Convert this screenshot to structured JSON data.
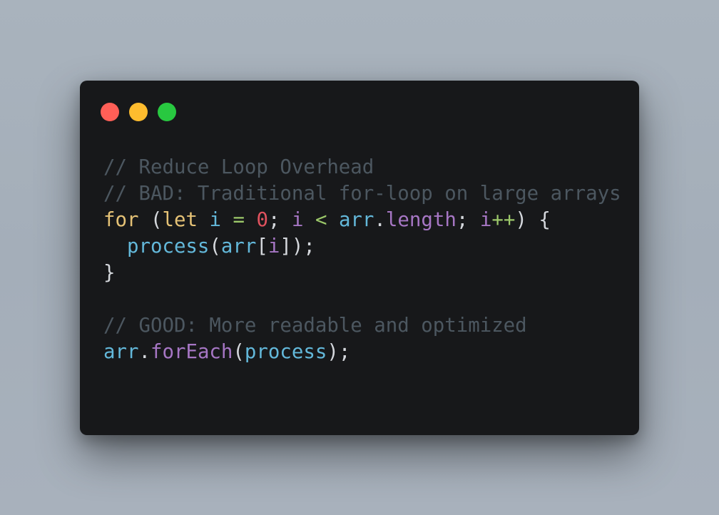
{
  "window": {
    "controls": [
      {
        "name": "close",
        "color": "#ff5f57"
      },
      {
        "name": "minimize",
        "color": "#febc2e"
      },
      {
        "name": "maximize",
        "color": "#28c840"
      }
    ]
  },
  "colors": {
    "background": "#a6b0bb",
    "editor": "#17181a",
    "comment": "#4c5760",
    "keyword": "#e5c276",
    "number": "#e0525e",
    "identifier": "#63b8da",
    "variable": "#a676c4",
    "operator": "#9cc86a",
    "punctuation": "#d4d7dc"
  },
  "code": {
    "lines": [
      [
        {
          "t": "// Reduce Loop Overhead",
          "k": "comment"
        }
      ],
      [
        {
          "t": "// BAD: Traditional for-loop on large arrays",
          "k": "comment"
        }
      ],
      [
        {
          "t": "for",
          "k": "keyword"
        },
        {
          "t": " (",
          "k": "punct"
        },
        {
          "t": "let",
          "k": "keyword"
        },
        {
          "t": " ",
          "k": "punct"
        },
        {
          "t": "i",
          "k": "ident"
        },
        {
          "t": " ",
          "k": "punct"
        },
        {
          "t": "=",
          "k": "op"
        },
        {
          "t": " ",
          "k": "punct"
        },
        {
          "t": "0",
          "k": "number"
        },
        {
          "t": "; ",
          "k": "punct"
        },
        {
          "t": "i",
          "k": "var"
        },
        {
          "t": " ",
          "k": "punct"
        },
        {
          "t": "<",
          "k": "op"
        },
        {
          "t": " ",
          "k": "punct"
        },
        {
          "t": "arr",
          "k": "ident"
        },
        {
          "t": ".",
          "k": "punct"
        },
        {
          "t": "length",
          "k": "var"
        },
        {
          "t": "; ",
          "k": "punct"
        },
        {
          "t": "i",
          "k": "var"
        },
        {
          "t": "++",
          "k": "op"
        },
        {
          "t": ") {",
          "k": "punct"
        }
      ],
      [
        {
          "t": "  ",
          "k": "punct"
        },
        {
          "t": "process",
          "k": "ident"
        },
        {
          "t": "(",
          "k": "punct"
        },
        {
          "t": "arr",
          "k": "ident"
        },
        {
          "t": "[",
          "k": "punct"
        },
        {
          "t": "i",
          "k": "var"
        },
        {
          "t": "]);",
          "k": "punct"
        }
      ],
      [
        {
          "t": "}",
          "k": "punct"
        }
      ],
      [],
      [
        {
          "t": "// GOOD: More readable and optimized",
          "k": "comment"
        }
      ],
      [
        {
          "t": "arr",
          "k": "ident"
        },
        {
          "t": ".",
          "k": "punct"
        },
        {
          "t": "forEach",
          "k": "var"
        },
        {
          "t": "(",
          "k": "punct"
        },
        {
          "t": "process",
          "k": "ident"
        },
        {
          "t": ");",
          "k": "punct"
        }
      ]
    ]
  }
}
